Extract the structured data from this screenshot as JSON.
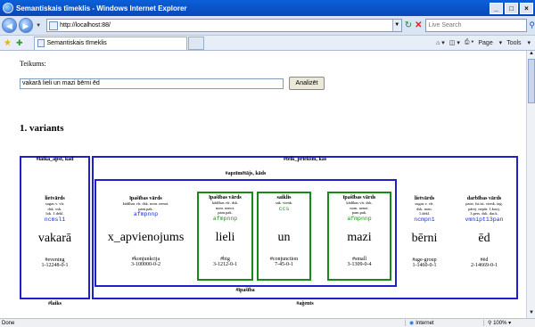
{
  "window": {
    "title": "Semantiskais tīmeklis - Windows Internet Explorer",
    "min": "_",
    "max": "□",
    "close": "×"
  },
  "addressbar": {
    "url": "http://localhost:88/",
    "search_placeholder": "Live Search"
  },
  "tabs": [
    {
      "label": "Semantiskais tīmeklis"
    }
  ],
  "command_bar": {
    "page": "Page",
    "tools": "Tools"
  },
  "form": {
    "label": "Teikums:",
    "input_value": "vakarā lieli un mazi bērni ēd",
    "button": "Analizēt"
  },
  "variant_heading": "1. variants",
  "frames": {
    "laika_top": "#laika_apst, kad",
    "teik_top": "#teik_priekšm, kas",
    "apzim_top": "#apzīmētājs, kāds",
    "ipasiba_bottom": "#īpašība",
    "laiks_bottom": "#laiks",
    "agents_bottom": "#aģents"
  },
  "words": [
    {
      "pos": "lietvārds",
      "feats": [
        "sugas v. vīr.",
        "dsk. vsk.",
        "lok. 1.dekl."
      ],
      "tag": "ncmsl1",
      "form": "vakarā",
      "sem": "#evening",
      "id": "1-12248-0-1"
    },
    {
      "pos": "īpašības vārds",
      "feats": [
        "kādības vīr. dsk. nom. nenot.",
        "pam.pak."
      ],
      "tag": "afmpnnp",
      "form": "x_apvienojums",
      "sem": "#konjunkcija",
      "id": "3-100000-0-2"
    },
    {
      "pos": "īpašības vārds",
      "feats": [
        "kādības vīr. dsk.",
        "nom. nenot.",
        "pam.pak."
      ],
      "tag": "afmpnnp",
      "form": "lieli",
      "sem": "#big",
      "id": "3-1212-0-1"
    },
    {
      "pos": "saiklis",
      "feats": [
        "sak. vienk."
      ],
      "tag": "ccs",
      "form": "un",
      "sem": "#conjunction",
      "id": "7-45-0-1"
    },
    {
      "pos": "īpašības vārds",
      "feats": [
        "kādības vīr. dsk.",
        "nom. nenot.",
        "pam.pak."
      ],
      "tag": "afmpnnp",
      "form": "mazi",
      "sem": "#small",
      "id": "3-1309-0-4"
    },
    {
      "pos": "lietvārds",
      "feats": [
        "sugas v. vīr.",
        "dsk. nom.",
        "1.dekl."
      ],
      "tag": "ncmpn1",
      "form": "bērni",
      "sem": "#age-group",
      "id": "1-1460-0-1"
    },
    {
      "pos": "darbības vārds",
      "feats": [
        "patst. īst.ist. vienk. tag.",
        "pārej. nepār. 1.konj.",
        "3.pers. dsk. dar.k."
      ],
      "tag": "vmnipt13pan",
      "form": "ēd",
      "sem": "#ēd",
      "id": "2-14669-0-1"
    }
  ],
  "status": {
    "left": "Done",
    "zone": "Internet",
    "zoom": "100%"
  },
  "colors": {
    "frame_blue": "#2020c8",
    "frame_green": "#178a17",
    "tag_blue": "#1a2dd8",
    "tag_green": "#129812"
  }
}
